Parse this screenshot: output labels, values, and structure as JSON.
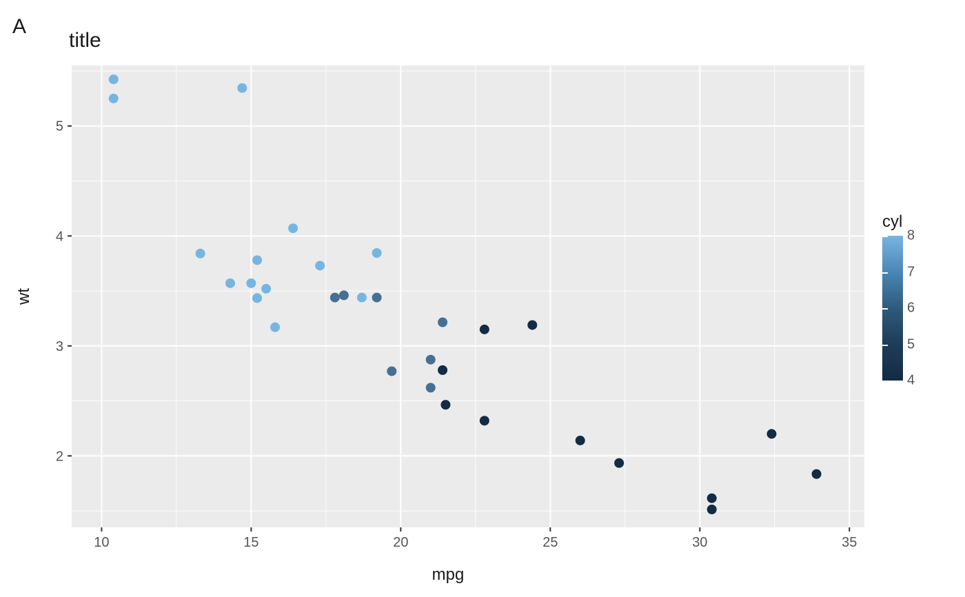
{
  "tag": "A",
  "title": "title",
  "axes": {
    "xlabel": "mpg",
    "ylabel": "wt",
    "x_ticks": [
      10,
      15,
      20,
      25,
      30,
      35
    ],
    "y_ticks": [
      2,
      3,
      4,
      5
    ],
    "x_minor": [
      12.5,
      17.5,
      22.5,
      27.5,
      32.5
    ],
    "y_minor": [
      1.5,
      2.5,
      3.5,
      4.5,
      5.5
    ]
  },
  "legend": {
    "title": "cyl",
    "ticks": [
      4,
      5,
      6,
      7,
      8
    ],
    "range": [
      4,
      8
    ]
  },
  "chart_data": {
    "type": "scatter",
    "xlabel": "mpg",
    "ylabel": "wt",
    "xlim": [
      9,
      35.5
    ],
    "ylim": [
      1.35,
      5.55
    ],
    "color_var": "cyl",
    "color_range": [
      4,
      8
    ],
    "points": [
      {
        "mpg": 21.0,
        "wt": 2.62,
        "cyl": 6
      },
      {
        "mpg": 21.0,
        "wt": 2.875,
        "cyl": 6
      },
      {
        "mpg": 22.8,
        "wt": 2.32,
        "cyl": 4
      },
      {
        "mpg": 21.4,
        "wt": 3.215,
        "cyl": 6
      },
      {
        "mpg": 18.7,
        "wt": 3.44,
        "cyl": 8
      },
      {
        "mpg": 18.1,
        "wt": 3.46,
        "cyl": 6
      },
      {
        "mpg": 14.3,
        "wt": 3.57,
        "cyl": 8
      },
      {
        "mpg": 24.4,
        "wt": 3.19,
        "cyl": 4
      },
      {
        "mpg": 22.8,
        "wt": 3.15,
        "cyl": 4
      },
      {
        "mpg": 19.2,
        "wt": 3.44,
        "cyl": 6
      },
      {
        "mpg": 17.8,
        "wt": 3.44,
        "cyl": 6
      },
      {
        "mpg": 16.4,
        "wt": 4.07,
        "cyl": 8
      },
      {
        "mpg": 17.3,
        "wt": 3.73,
        "cyl": 8
      },
      {
        "mpg": 15.2,
        "wt": 3.78,
        "cyl": 8
      },
      {
        "mpg": 10.4,
        "wt": 5.25,
        "cyl": 8
      },
      {
        "mpg": 10.4,
        "wt": 5.424,
        "cyl": 8
      },
      {
        "mpg": 14.7,
        "wt": 5.345,
        "cyl": 8
      },
      {
        "mpg": 32.4,
        "wt": 2.2,
        "cyl": 4
      },
      {
        "mpg": 30.4,
        "wt": 1.615,
        "cyl": 4
      },
      {
        "mpg": 33.9,
        "wt": 1.835,
        "cyl": 4
      },
      {
        "mpg": 21.5,
        "wt": 2.465,
        "cyl": 4
      },
      {
        "mpg": 15.5,
        "wt": 3.52,
        "cyl": 8
      },
      {
        "mpg": 15.2,
        "wt": 3.435,
        "cyl": 8
      },
      {
        "mpg": 13.3,
        "wt": 3.84,
        "cyl": 8
      },
      {
        "mpg": 19.2,
        "wt": 3.845,
        "cyl": 8
      },
      {
        "mpg": 27.3,
        "wt": 1.935,
        "cyl": 4
      },
      {
        "mpg": 26.0,
        "wt": 2.14,
        "cyl": 4
      },
      {
        "mpg": 30.4,
        "wt": 1.513,
        "cyl": 4
      },
      {
        "mpg": 15.8,
        "wt": 3.17,
        "cyl": 8
      },
      {
        "mpg": 19.7,
        "wt": 2.77,
        "cyl": 6
      },
      {
        "mpg": 15.0,
        "wt": 3.57,
        "cyl": 8
      },
      {
        "mpg": 21.4,
        "wt": 2.78,
        "cyl": 4
      }
    ]
  }
}
